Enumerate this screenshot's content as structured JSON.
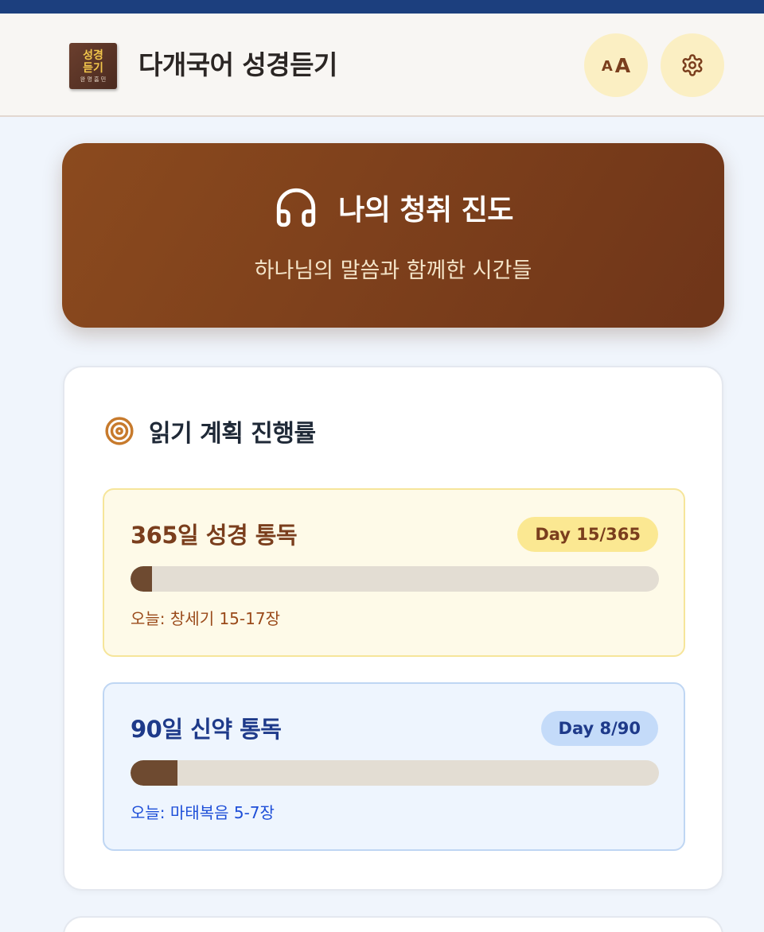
{
  "header": {
    "logo_line1": "성경",
    "logo_line2": "듣기",
    "logo_line3": "완 명 흠 민",
    "title": "다개국어 성경듣기",
    "font_button": {
      "small": "A",
      "large": "A",
      "icon": "font-size-icon"
    },
    "settings_button": {
      "icon": "gear-icon"
    }
  },
  "hero": {
    "icon": "headphones-icon",
    "title": "나의 청취 진도",
    "subtitle": "하나님의 말씀과 함께한 시간들"
  },
  "plans_card": {
    "icon": "target-icon",
    "title": "읽기 계획 진행률",
    "plans": [
      {
        "name": "365일 성경 통독",
        "badge": "Day 15/365",
        "progress_fraction": 0.041,
        "today": "오늘: 창세기 15-17장"
      },
      {
        "name": "90일 신약 통독",
        "badge": "Day 8/90",
        "progress_fraction": 0.089,
        "today": "오늘: 마태복음 5-7장"
      }
    ]
  },
  "colors": {
    "top_bar": "#1c3f7e",
    "hero_brown": "#7f401c",
    "accent_yellow": "#fbe892",
    "accent_blue": "#c4dbf9",
    "progress_fill": "#6e4a30"
  }
}
